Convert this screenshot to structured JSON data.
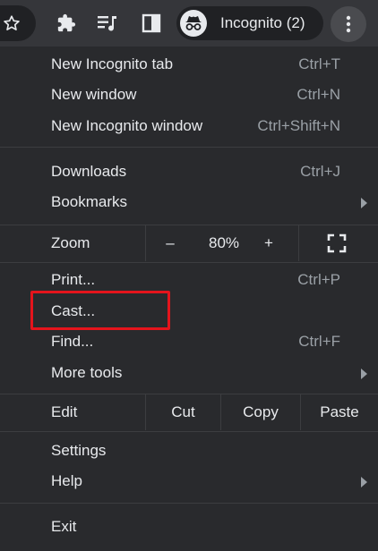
{
  "toolbar": {
    "icons": [
      "star-icon",
      "extensions-icon",
      "media-control-icon",
      "side-panel-icon",
      "incognito-icon",
      "more-vert-icon"
    ],
    "profile_label": "Incognito (2)"
  },
  "menu": {
    "new_incognito_tab": {
      "label": "New Incognito tab",
      "shortcut": "Ctrl+T"
    },
    "new_window": {
      "label": "New window",
      "shortcut": "Ctrl+N"
    },
    "new_incognito_window": {
      "label": "New Incognito window",
      "shortcut": "Ctrl+Shift+N"
    },
    "downloads": {
      "label": "Downloads",
      "shortcut": "Ctrl+J"
    },
    "bookmarks": {
      "label": "Bookmarks"
    },
    "zoom": {
      "label": "Zoom",
      "minus": "–",
      "value": "80%",
      "plus": "+"
    },
    "print": {
      "label": "Print...",
      "shortcut": "Ctrl+P"
    },
    "cast": {
      "label": "Cast..."
    },
    "find": {
      "label": "Find...",
      "shortcut": "Ctrl+F"
    },
    "more_tools": {
      "label": "More tools"
    },
    "edit": {
      "label": "Edit",
      "cut": "Cut",
      "copy": "Copy",
      "paste": "Paste"
    },
    "settings": {
      "label": "Settings"
    },
    "help": {
      "label": "Help"
    },
    "exit": {
      "label": "Exit"
    }
  },
  "colors": {
    "menu_bg": "#292a2d",
    "toolbar_bg": "#35363a",
    "text": "#e8eaed",
    "shortcut_text": "#9aa0a6",
    "highlight": "#e4141c"
  }
}
